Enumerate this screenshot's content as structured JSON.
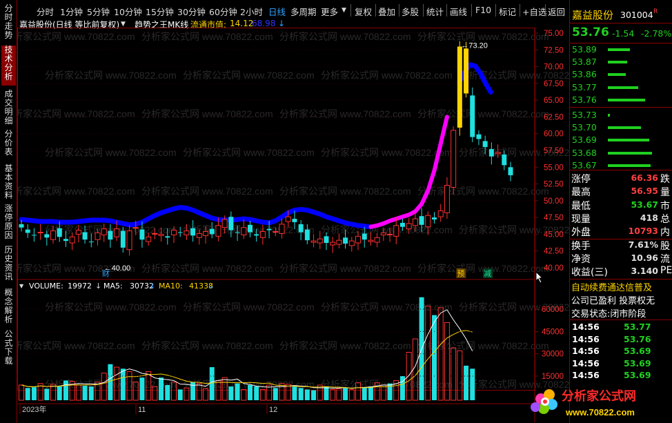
{
  "left_tabs": [
    "分时走势",
    "技术分析",
    "成交明细",
    "分价表",
    "基本资料",
    "涨停原因",
    "历史资讯",
    "概念解析",
    "公式下载"
  ],
  "toolbar": {
    "items": [
      "分时",
      "1分钟",
      "5分钟",
      "10分钟",
      "15分钟",
      "30分钟",
      "60分钟",
      "2小时",
      "日线",
      "多周期",
      "更多",
      "复权",
      "叠加",
      "多股",
      "统计",
      "画线",
      "F10",
      "标记",
      "+自选",
      "返回"
    ],
    "selected": "日线"
  },
  "info_line": {
    "stock": "嘉益股份(日线 等比前复权)",
    "indicator": "趋势之王MK线",
    "float_label": "流通市值:",
    "float_value": "14.12",
    "extra_value": "68.98"
  },
  "price_axis": [
    "75.00",
    "72.50",
    "70.00",
    "67.50",
    "65.00",
    "62.50",
    "60.00",
    "57.50",
    "55.00",
    "52.50",
    "50.00",
    "47.50",
    "45.00",
    "42.50",
    "40.00"
  ],
  "annotations": {
    "high_label": "73.20",
    "low_label": "40.00",
    "marker_cai": "财",
    "marker_yu": "预",
    "marker_jian": "减"
  },
  "volume_line": {
    "label": "VOLUME:",
    "volume": "19972",
    "ma5_label": "MA5:",
    "ma5": "30732",
    "ma10_label": "MA10:",
    "ma10": "41338"
  },
  "volume_axis": [
    "60000",
    "45000",
    "30000",
    "15000"
  ],
  "date_axis": [
    "2023年",
    "11",
    "12"
  ],
  "right_panel": {
    "name": "嘉益股份",
    "code": "301004",
    "flag": "R",
    "price": "53.76",
    "change": "-1.54",
    "pct": "-2.78%",
    "ask": [
      {
        "p": "53.89",
        "w": 32
      },
      {
        "p": "53.87",
        "w": 28
      },
      {
        "p": "53.86",
        "w": 26
      },
      {
        "p": "53.77",
        "w": 44
      },
      {
        "p": "53.76",
        "w": 54
      }
    ],
    "bid": [
      {
        "p": "53.73",
        "w": 3
      },
      {
        "p": "53.70",
        "w": 48
      },
      {
        "p": "53.69",
        "w": 60
      },
      {
        "p": "53.68",
        "w": 64
      },
      {
        "p": "53.67",
        "w": 62
      }
    ],
    "stats": [
      {
        "k": "涨停",
        "v": "66.36",
        "vc": "#ff4040",
        "k2": "跌"
      },
      {
        "k": "最高",
        "v": "56.95",
        "vc": "#ff4040",
        "k2": "量"
      },
      {
        "k": "最低",
        "v": "53.67",
        "vc": "#20d020",
        "k2": "市"
      },
      {
        "k": "现量",
        "v": "418",
        "vc": "#e0e0e0",
        "k2": "总"
      },
      {
        "k": "外盘",
        "v": "10793",
        "vc": "#ff4040",
        "k2": "内"
      },
      {
        "k": "换手",
        "v": "7.61%",
        "vc": "#e0e0e0",
        "k2": "股"
      },
      {
        "k": "净资",
        "v": "10.96",
        "vc": "#e0e0e0",
        "k2": "流"
      },
      {
        "k": "收益(三)",
        "v": "3.140",
        "vc": "#e0e0e0",
        "k2": "PE"
      }
    ],
    "notice": [
      "自动续费通达信普及",
      "公司已盈利 投票权无",
      "交易状态:闭市阶段"
    ],
    "ticks": [
      {
        "t": "14:56",
        "p": "53.77",
        "c": "#20d020"
      },
      {
        "t": "14:56",
        "p": "53.76",
        "c": "#20d020"
      },
      {
        "t": "14:56",
        "p": "53.69",
        "c": "#20d020"
      },
      {
        "t": "14:56",
        "p": "53.69",
        "c": "#20d020"
      },
      {
        "t": "14:56",
        "p": "53.69",
        "c": "#20d020"
      }
    ]
  },
  "watermark": "分析家公式网 www.70822.com",
  "logo": {
    "text": "分析家公式网",
    "url": "www.70822.com"
  },
  "colors": {
    "up": "#ff3030",
    "down": "#20e0e0",
    "trend_blue": "#0000ff",
    "trend_magenta": "#ff00ff",
    "trend_yellow": "#ffd400",
    "panel_border": "#8a0000"
  }
}
